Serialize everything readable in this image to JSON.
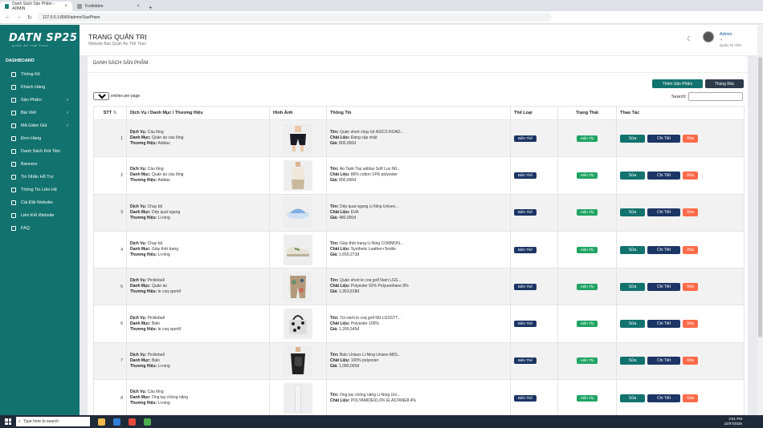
{
  "browser": {
    "tabs": [
      {
        "title": "Danh Sách Sản Phẩm - ADMIN"
      },
      {
        "title": "Forbidden"
      }
    ],
    "url": "127.0.0.1:8000/admin/SanPham"
  },
  "sidebar": {
    "logo": "DATN SP25",
    "logo_sub": "QUẦN ÁO THỂ THAO",
    "section": "DASHBOARD",
    "items": [
      {
        "label": "Thống Kê",
        "icon": "home-icon"
      },
      {
        "label": "Khách Hàng",
        "icon": "users-icon"
      },
      {
        "label": "Sản Phẩm",
        "icon": "grid-icon",
        "expand": "›"
      },
      {
        "label": "Bài Viết",
        "icon": "document-icon",
        "expand": "›"
      },
      {
        "label": "Mã Giảm Giá",
        "icon": "tag-icon",
        "expand": "›"
      },
      {
        "label": "Đơn Hàng",
        "icon": "cart-icon"
      },
      {
        "label": "Danh Sách Rút Tiền",
        "icon": "wallet-icon"
      },
      {
        "label": "Banners",
        "icon": "image-icon"
      },
      {
        "label": "Tin Nhắn Hỗ Trợ",
        "icon": "chat-icon"
      },
      {
        "label": "Thông Tin Liên Hệ",
        "icon": "contact-icon"
      },
      {
        "label": "Cài Đặt Website",
        "icon": "gear-icon"
      },
      {
        "label": "Liên Kết Website",
        "icon": "link-icon"
      },
      {
        "label": "FAQ",
        "icon": "question-icon"
      }
    ]
  },
  "header": {
    "title": "TRANG QUẢN TRỊ",
    "subtitle": "Website Bán Quần Áo Thể Thao",
    "user_name": "Admin",
    "user_role": "Quản Trị Viên"
  },
  "page": {
    "card_title": "DANH SÁCH SẢN PHẨM",
    "add_button": "Thêm Sản Phẩm",
    "trash_button": "Thùng Rác",
    "entries_value": "10",
    "entries_label": "entries per page",
    "search_label": "Search:",
    "columns": [
      "STT",
      "Dịch Vụ / Danh Mục / Thương Hiệu",
      "Hình Ảnh",
      "Thông Tin",
      "Thể Loại",
      "Trạng Thái",
      "Thao Tác"
    ],
    "sort_icon": "⇅",
    "label_service": "Dịch Vụ:",
    "label_category": "Danh Mục:",
    "label_brand": "Thương Hiệu:",
    "label_name": "Tên:",
    "label_material": "Chất Liệu:",
    "label_price": "Giá:",
    "btn_edit": "Sửa",
    "btn_detail": "Chi Tiết",
    "btn_delete": "Xóa",
    "rows": [
      {
        "stt": "1",
        "service": "Cầu lông",
        "category": "Quần áo cầu lông",
        "brand": "Adidas",
        "name": "Quần short chạy bộ ASICS ROAD...",
        "material": "Đang cập nhật",
        "price": "800,000đ",
        "type": "Biến Thể",
        "status": "Hiển Thị",
        "img": "shorts"
      },
      {
        "stt": "2",
        "service": "Cầu lông",
        "category": "Quần áo cầu lông",
        "brand": "Adidas",
        "name": "Áo Tank Top adidas Soft Lux Nữ...",
        "material": "86% cotton 14% polyester",
        "price": "800,000đ",
        "type": "Biến Thể",
        "status": "Hiển Thị",
        "img": "tank"
      },
      {
        "stt": "3",
        "service": "Chạy bộ",
        "category": "Dép quai ngang",
        "brand": "Li-ning",
        "name": "Dép quai ngang Li-Ning Unisex...",
        "material": "EVA",
        "price": "480,000đ",
        "type": "Biến Thể",
        "status": "Hiển Thị",
        "img": "slide"
      },
      {
        "stt": "4",
        "service": "Chạy bộ",
        "category": "Giày thời trang",
        "brand": "Li-ning",
        "name": "Giày thời trang Li-Ning COMMON...",
        "material": "Synthetic Leather+Textile",
        "price": "1,659,273đ",
        "type": "Biến Thể",
        "status": "Hiển Thị",
        "img": "shoe"
      },
      {
        "stt": "5",
        "service": "Pickleball",
        "category": "Quần áo",
        "brand": "le coq sportif",
        "name": "Quần short le coq golf Nam LGS...",
        "material": "Polyester 92% Polyurethane 8%",
        "price": "1,953,818đ",
        "type": "Biến Thể",
        "status": "Hiển Thị",
        "img": "pshorts"
      },
      {
        "stt": "6",
        "service": "Pickleball",
        "category": "Balo",
        "brand": "le coq sportif",
        "name": "Túi xách le coq golf Nữ LGSSTT...",
        "material": "Polyester 100%",
        "price": "1,266,545đ",
        "type": "Biến Thể",
        "status": "Hiển Thị",
        "img": "bag"
      },
      {
        "stt": "7",
        "service": "Pickleball",
        "category": "Balo",
        "brand": "Li-ning",
        "name": "Balo Unisex Li-Ning Unisex ABS...",
        "material": "100% polyester",
        "price": "1,080,000đ",
        "type": "Biến Thể",
        "status": "Hiển Thị",
        "img": "backpack"
      },
      {
        "stt": "8",
        "service": "Cầu lông",
        "category": "Ống tay chống nắng",
        "brand": "Li-ning",
        "name": "Ống tay chống nắng Li-Ning Uni...",
        "material": "POLYAMIDE91.6% ELASTANE8.4%",
        "price": "",
        "type": "Biến Thể",
        "status": "Hiển Thị",
        "img": "sleeve"
      }
    ]
  },
  "taskbar": {
    "search_placeholder": "Type here to search",
    "time": "3:51 PM",
    "date": "22/07/2025"
  }
}
